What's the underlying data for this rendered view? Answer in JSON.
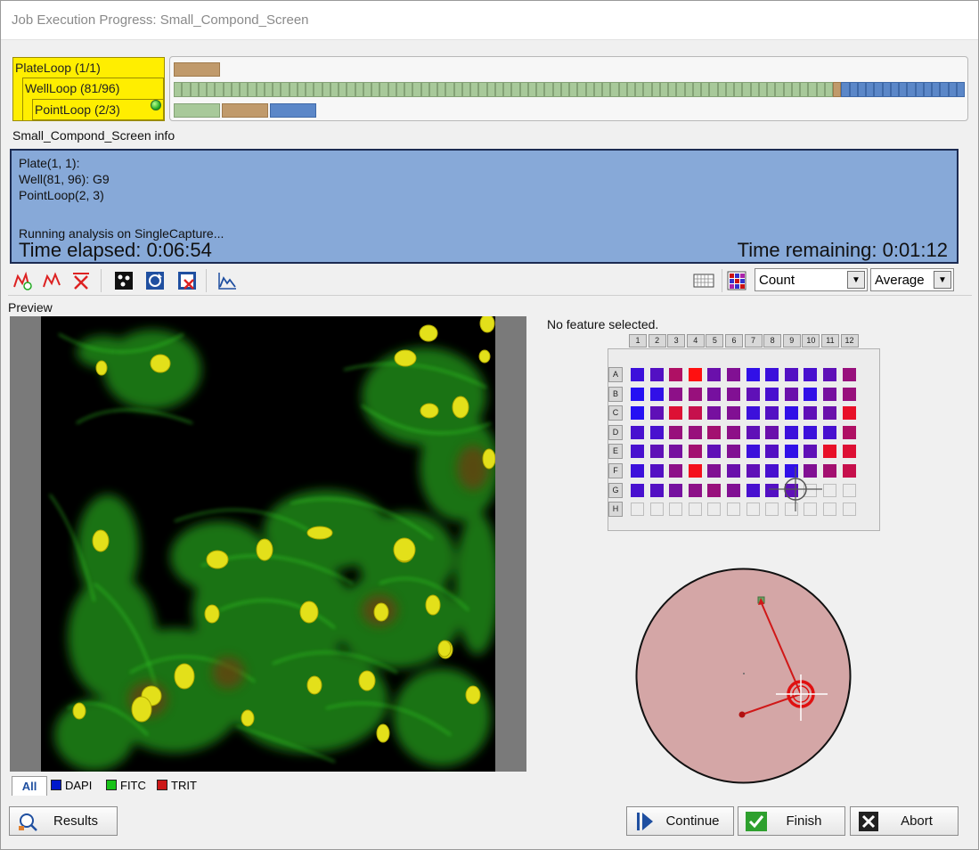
{
  "window": {
    "title": "Job Execution Progress: Small_Compond_Screen"
  },
  "loops": {
    "plate": "PlateLoop (1/1)",
    "well": "WellLoop (81/96)",
    "point": "PointLoop (2/3)"
  },
  "progress": {
    "wells_total": 96,
    "wells_done": 80,
    "current_well": 81,
    "points_total": 3,
    "current_point": 2
  },
  "info": {
    "label": "Small_Compond_Screen info",
    "plate_line": "Plate(1, 1):",
    "well_line": "Well(81, 96): G9",
    "point_line": "PointLoop(2, 3)",
    "status_line": "Running analysis on SingleCapture...",
    "elapsed": "Time elapsed: 0:06:54",
    "remaining": "Time remaining: 0:01:12"
  },
  "toolbar": {
    "icons": [
      "graph-add-icon",
      "graph-icon",
      "graph-remove-icon",
      "dots-icon",
      "refresh-icon",
      "selected-remove-icon",
      "histogram-icon",
      "grid-view-icon",
      "heatmap-icon"
    ],
    "metric_select": "Count",
    "aggregate_select": "Average"
  },
  "preview": {
    "label": "Preview",
    "tabs": [
      {
        "label": "All",
        "color": ""
      },
      {
        "label": "DAPI",
        "color": "#0018cc"
      },
      {
        "label": "FITC",
        "color": "#18c218"
      },
      {
        "label": "TRIT",
        "color": "#cc1818"
      }
    ]
  },
  "plate": {
    "feature_label": "No feature selected.",
    "columns": [
      "1",
      "2",
      "3",
      "4",
      "5",
      "6",
      "7",
      "8",
      "9",
      "10",
      "11",
      "12"
    ],
    "rows": [
      "A",
      "B",
      "C",
      "D",
      "E",
      "F",
      "G",
      "H"
    ],
    "heat": [
      [
        0.15,
        0.25,
        0.65,
        1.0,
        0.35,
        0.45,
        0.1,
        0.15,
        0.25,
        0.2,
        0.3,
        0.55
      ],
      [
        0.05,
        0.1,
        0.5,
        0.55,
        0.4,
        0.45,
        0.3,
        0.2,
        0.35,
        0.1,
        0.4,
        0.55
      ],
      [
        0.05,
        0.3,
        0.85,
        0.75,
        0.4,
        0.45,
        0.15,
        0.25,
        0.1,
        0.3,
        0.35,
        0.9
      ],
      [
        0.2,
        0.2,
        0.55,
        0.55,
        0.6,
        0.5,
        0.3,
        0.35,
        0.15,
        0.15,
        0.2,
        0.65
      ],
      [
        0.2,
        0.3,
        0.4,
        0.6,
        0.3,
        0.45,
        0.15,
        0.25,
        0.1,
        0.3,
        0.9,
        0.85
      ],
      [
        0.15,
        0.25,
        0.5,
        0.95,
        0.45,
        0.35,
        0.3,
        0.2,
        0.1,
        0.45,
        0.6,
        0.75
      ],
      [
        0.2,
        0.25,
        0.4,
        0.5,
        0.55,
        0.45,
        0.2,
        0.25,
        0.3,
        null,
        null,
        null
      ],
      [
        null,
        null,
        null,
        null,
        null,
        null,
        null,
        null,
        null,
        null,
        null,
        null
      ]
    ],
    "low_color": "#1a10ff",
    "high_color": "#ff1010",
    "current_well": "G9"
  },
  "buttons": {
    "results": "Results",
    "continue": "Continue",
    "finish": "Finish",
    "abort": "Abort"
  }
}
